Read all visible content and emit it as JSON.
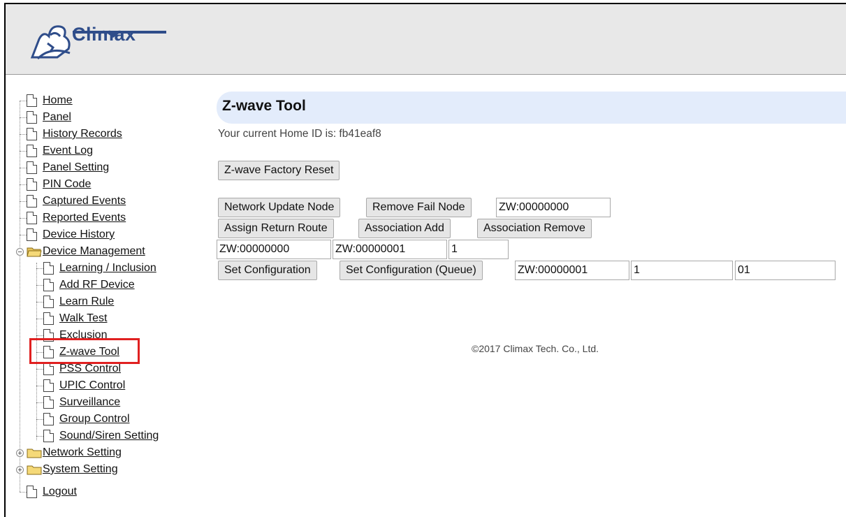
{
  "brand": {
    "logo_text": "Climax"
  },
  "tree": {
    "items": [
      {
        "label": "Home"
      },
      {
        "label": "Panel"
      },
      {
        "label": "History Records"
      },
      {
        "label": "Event Log"
      },
      {
        "label": "Panel Setting"
      },
      {
        "label": "PIN Code"
      },
      {
        "label": "Captured Events"
      },
      {
        "label": "Reported Events"
      },
      {
        "label": "Device History"
      },
      {
        "label": "Device Management"
      },
      {
        "label": "Learning / Inclusion"
      },
      {
        "label": "Add RF Device"
      },
      {
        "label": "Learn Rule"
      },
      {
        "label": "Walk Test"
      },
      {
        "label": "Exclusion"
      },
      {
        "label": "Z-wave Tool"
      },
      {
        "label": "PSS Control"
      },
      {
        "label": "UPIC Control"
      },
      {
        "label": "Surveillance"
      },
      {
        "label": "Group Control"
      },
      {
        "label": "Sound/Siren Setting"
      },
      {
        "label": "Network Setting"
      },
      {
        "label": "System Setting"
      },
      {
        "label": "Logout"
      }
    ]
  },
  "main": {
    "title": "Z-wave Tool",
    "home_id_text": "Your current Home ID is: fb41eaf8",
    "factory_reset_label": "Z-wave Factory Reset",
    "network_update_label": "Network Update Node",
    "remove_fail_label": "Remove Fail Node",
    "node_id_value": "ZW:00000000",
    "assign_return_label": "Assign Return Route",
    "assoc_add_label": "Association Add",
    "assoc_remove_label": "Association Remove",
    "assoc_node_value": "ZW:00000000",
    "assoc_target_value": "ZW:00000001",
    "assoc_group_value": "1",
    "set_config_label": "Set Configuration",
    "set_config_queue_label": "Set Configuration (Queue)",
    "config_node_value": "ZW:00000001",
    "config_param_value": "1",
    "config_value_value": "01"
  },
  "footer": {
    "copyright": "©2017 Climax Tech. Co., Ltd."
  },
  "colors": {
    "title_bar": "#e3ecfb",
    "header": "#e8e8e8",
    "highlight": "#e02020",
    "logo": "#2f4d8a"
  }
}
